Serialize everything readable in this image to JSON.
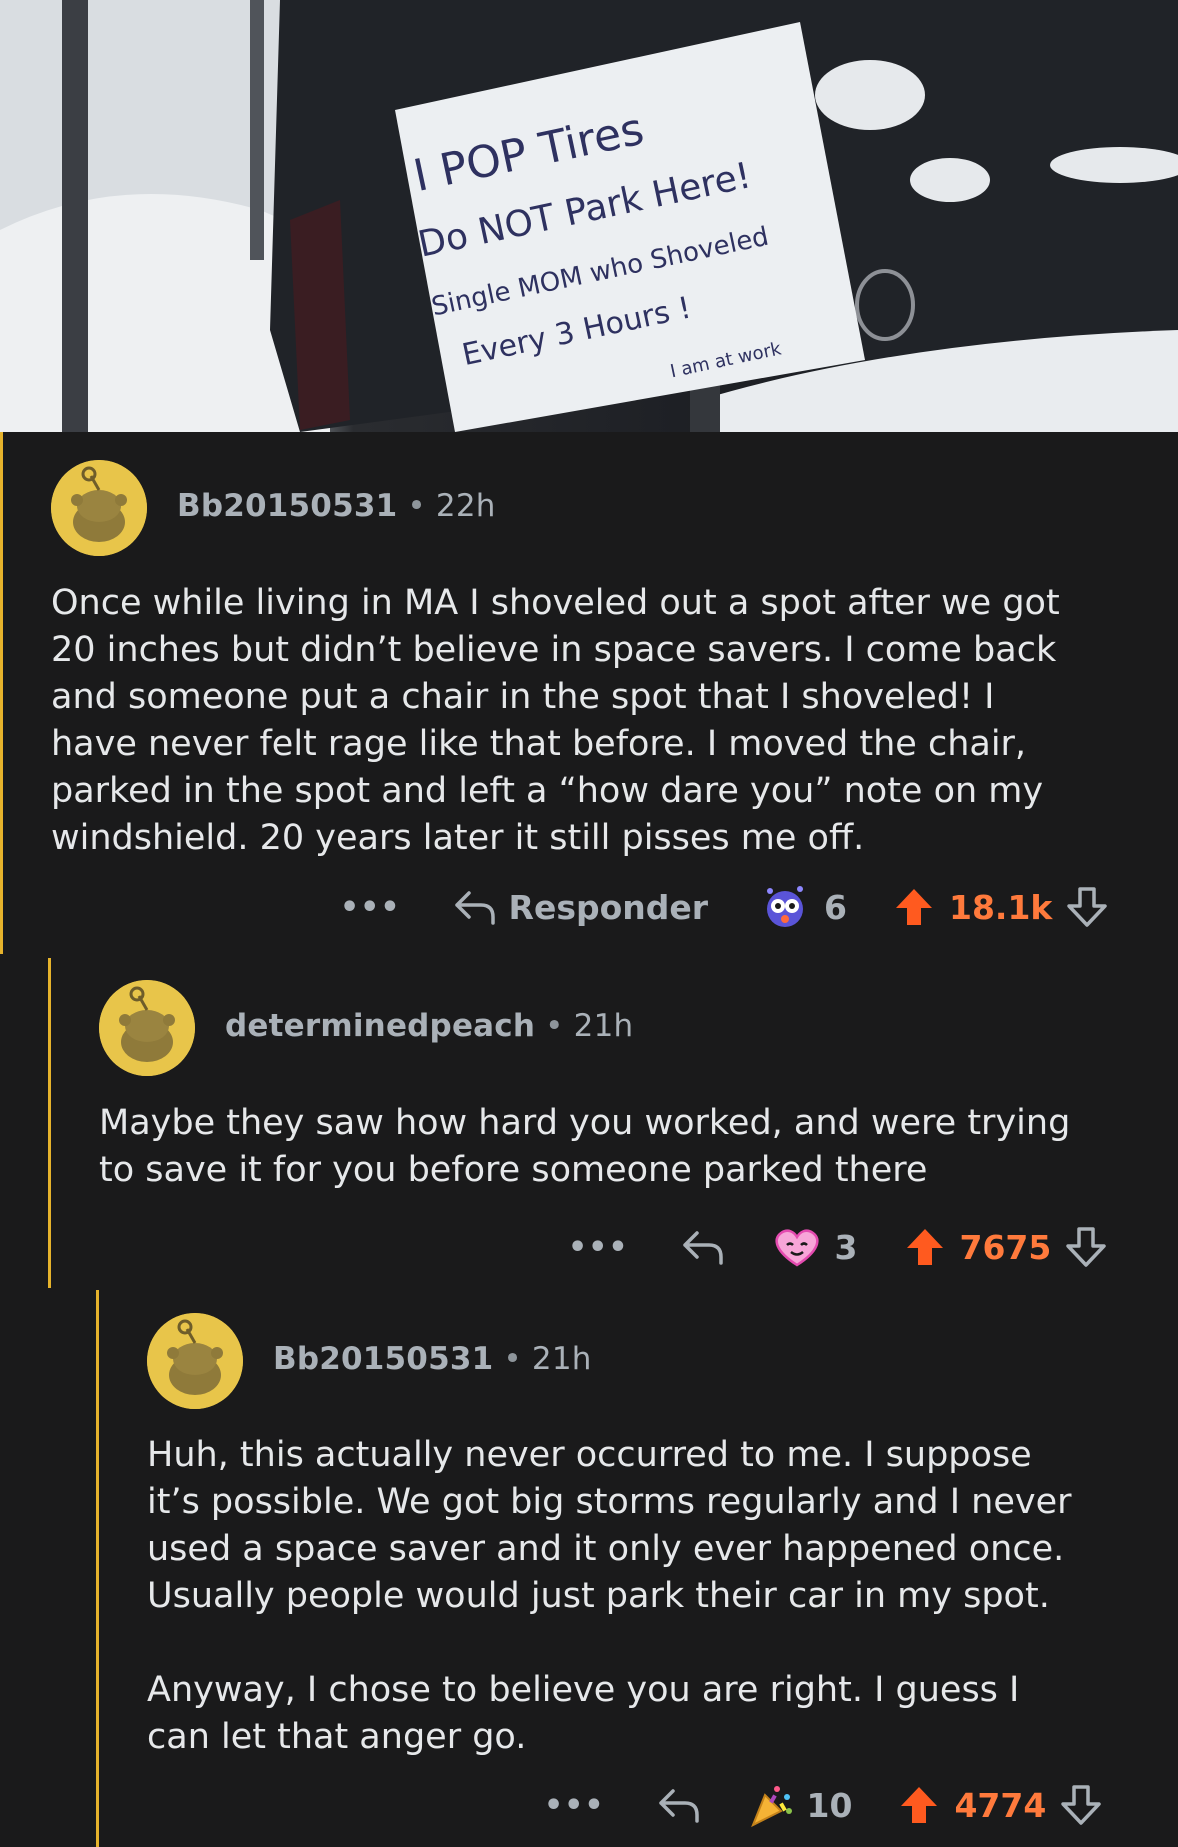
{
  "photo": {
    "sign_lines": [
      "I POP Tires",
      "Do NOT Park Here!",
      "Single MOM who Shoveled",
      "Every 3 Hours !",
      "I am at work"
    ]
  },
  "comments": [
    {
      "username": "Bb20150531",
      "separator": "•",
      "time": "22h",
      "body": "Once while living in MA I shoveled out a spot after we got\n20 inches but didn’t believe in space savers. I come back\nand someone put a chair in the spot that I shoveled! I\nhave never felt rage like that before. I moved the chair,\nparked in the spot and left a “how dare you” note on my\nwindshield. 20 years later it still pisses me off.",
      "more": "•••",
      "reply_label": "Responder",
      "award_count": "6",
      "upvotes": "18.1k"
    },
    {
      "username": "determinedpeach",
      "separator": "•",
      "time": "21h",
      "body": "Maybe they saw how hard you worked, and were trying\nto save it for you before someone parked there",
      "more": "•••",
      "award_count": "3",
      "upvotes": "7675"
    },
    {
      "username": "Bb20150531",
      "separator": "•",
      "time": "21h",
      "body": "Huh, this actually never occurred to me. I suppose\nit’s possible. We got big storms regularly and I never\nused a space saver and it only ever happened once.\nUsually people would just park their car in my spot.\n\nAnyway, I chose to believe you are right. I guess I\ncan let that anger go.",
      "more": "•••",
      "award_count": "10",
      "upvotes": "4774"
    }
  ],
  "colors": {
    "background": "#1a1a1b",
    "upvote": "#ff5a1f",
    "thread_line": "#e6b32c",
    "avatar": "#e8c54a"
  }
}
